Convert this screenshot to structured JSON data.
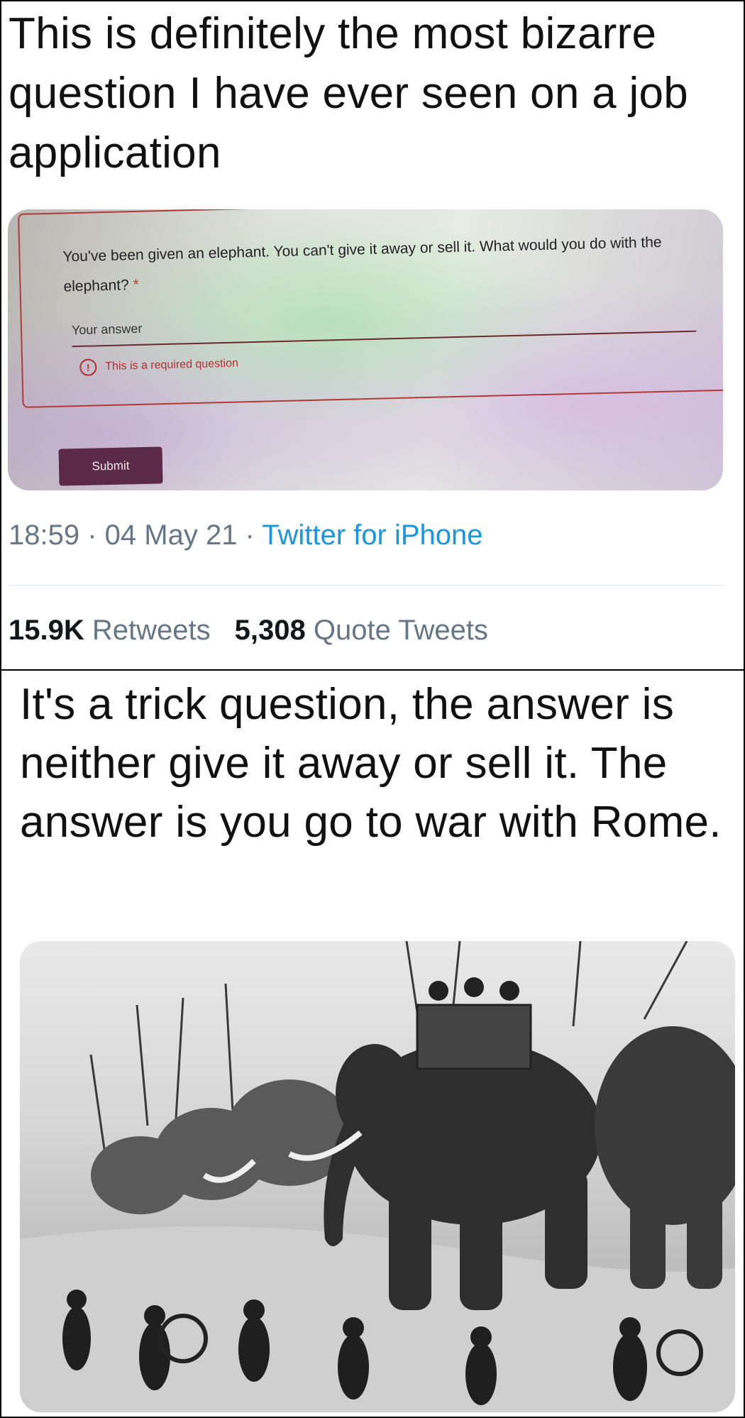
{
  "tweet1": {
    "text": "This is definitely the most bizarre question I have ever seen on a job application",
    "photo": {
      "question": "You've been given an elephant. You can't give it away or sell it. What would you do with the elephant?",
      "required_star": "*",
      "answer_placeholder": "Your answer",
      "error_icon": "!",
      "error_text": "This is a required question",
      "submit_label": "Submit"
    },
    "time": "18:59",
    "sep1": " · ",
    "date": "04 May 21",
    "sep2": " · ",
    "source": "Twitter for iPhone",
    "retweets_count": "15.9K",
    "retweets_label": "Retweets",
    "quotes_count": "5,308",
    "quotes_label": "Quote Tweets"
  },
  "tweet2": {
    "text": "It's a trick question, the answer is neither give it away or sell it. The answer is you go to war with Rome."
  },
  "colors": {
    "link": "#1b95e0",
    "meta_gray": "#657786",
    "submit_bg": "#5b2a48",
    "error_red": "#b03030"
  }
}
